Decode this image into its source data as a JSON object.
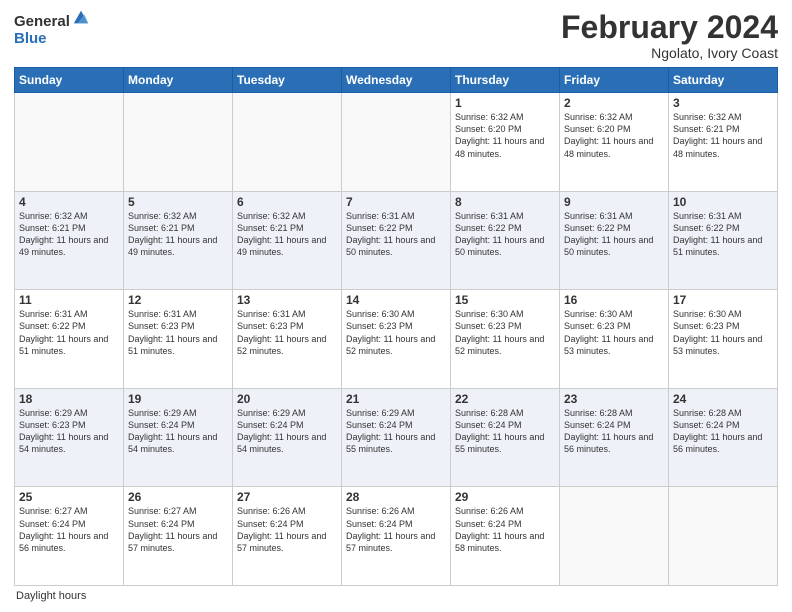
{
  "logo": {
    "general": "General",
    "blue": "Blue"
  },
  "title": "February 2024",
  "subtitle": "Ngolato, Ivory Coast",
  "days_of_week": [
    "Sunday",
    "Monday",
    "Tuesday",
    "Wednesday",
    "Thursday",
    "Friday",
    "Saturday"
  ],
  "footer": "Daylight hours",
  "weeks": [
    [
      {
        "day": "",
        "info": ""
      },
      {
        "day": "",
        "info": ""
      },
      {
        "day": "",
        "info": ""
      },
      {
        "day": "",
        "info": ""
      },
      {
        "day": "1",
        "info": "Sunrise: 6:32 AM\nSunset: 6:20 PM\nDaylight: 11 hours and 48 minutes."
      },
      {
        "day": "2",
        "info": "Sunrise: 6:32 AM\nSunset: 6:20 PM\nDaylight: 11 hours and 48 minutes."
      },
      {
        "day": "3",
        "info": "Sunrise: 6:32 AM\nSunset: 6:21 PM\nDaylight: 11 hours and 48 minutes."
      }
    ],
    [
      {
        "day": "4",
        "info": "Sunrise: 6:32 AM\nSunset: 6:21 PM\nDaylight: 11 hours and 49 minutes."
      },
      {
        "day": "5",
        "info": "Sunrise: 6:32 AM\nSunset: 6:21 PM\nDaylight: 11 hours and 49 minutes."
      },
      {
        "day": "6",
        "info": "Sunrise: 6:32 AM\nSunset: 6:21 PM\nDaylight: 11 hours and 49 minutes."
      },
      {
        "day": "7",
        "info": "Sunrise: 6:31 AM\nSunset: 6:22 PM\nDaylight: 11 hours and 50 minutes."
      },
      {
        "day": "8",
        "info": "Sunrise: 6:31 AM\nSunset: 6:22 PM\nDaylight: 11 hours and 50 minutes."
      },
      {
        "day": "9",
        "info": "Sunrise: 6:31 AM\nSunset: 6:22 PM\nDaylight: 11 hours and 50 minutes."
      },
      {
        "day": "10",
        "info": "Sunrise: 6:31 AM\nSunset: 6:22 PM\nDaylight: 11 hours and 51 minutes."
      }
    ],
    [
      {
        "day": "11",
        "info": "Sunrise: 6:31 AM\nSunset: 6:22 PM\nDaylight: 11 hours and 51 minutes."
      },
      {
        "day": "12",
        "info": "Sunrise: 6:31 AM\nSunset: 6:23 PM\nDaylight: 11 hours and 51 minutes."
      },
      {
        "day": "13",
        "info": "Sunrise: 6:31 AM\nSunset: 6:23 PM\nDaylight: 11 hours and 52 minutes."
      },
      {
        "day": "14",
        "info": "Sunrise: 6:30 AM\nSunset: 6:23 PM\nDaylight: 11 hours and 52 minutes."
      },
      {
        "day": "15",
        "info": "Sunrise: 6:30 AM\nSunset: 6:23 PM\nDaylight: 11 hours and 52 minutes."
      },
      {
        "day": "16",
        "info": "Sunrise: 6:30 AM\nSunset: 6:23 PM\nDaylight: 11 hours and 53 minutes."
      },
      {
        "day": "17",
        "info": "Sunrise: 6:30 AM\nSunset: 6:23 PM\nDaylight: 11 hours and 53 minutes."
      }
    ],
    [
      {
        "day": "18",
        "info": "Sunrise: 6:29 AM\nSunset: 6:23 PM\nDaylight: 11 hours and 54 minutes."
      },
      {
        "day": "19",
        "info": "Sunrise: 6:29 AM\nSunset: 6:24 PM\nDaylight: 11 hours and 54 minutes."
      },
      {
        "day": "20",
        "info": "Sunrise: 6:29 AM\nSunset: 6:24 PM\nDaylight: 11 hours and 54 minutes."
      },
      {
        "day": "21",
        "info": "Sunrise: 6:29 AM\nSunset: 6:24 PM\nDaylight: 11 hours and 55 minutes."
      },
      {
        "day": "22",
        "info": "Sunrise: 6:28 AM\nSunset: 6:24 PM\nDaylight: 11 hours and 55 minutes."
      },
      {
        "day": "23",
        "info": "Sunrise: 6:28 AM\nSunset: 6:24 PM\nDaylight: 11 hours and 56 minutes."
      },
      {
        "day": "24",
        "info": "Sunrise: 6:28 AM\nSunset: 6:24 PM\nDaylight: 11 hours and 56 minutes."
      }
    ],
    [
      {
        "day": "25",
        "info": "Sunrise: 6:27 AM\nSunset: 6:24 PM\nDaylight: 11 hours and 56 minutes."
      },
      {
        "day": "26",
        "info": "Sunrise: 6:27 AM\nSunset: 6:24 PM\nDaylight: 11 hours and 57 minutes."
      },
      {
        "day": "27",
        "info": "Sunrise: 6:26 AM\nSunset: 6:24 PM\nDaylight: 11 hours and 57 minutes."
      },
      {
        "day": "28",
        "info": "Sunrise: 6:26 AM\nSunset: 6:24 PM\nDaylight: 11 hours and 57 minutes."
      },
      {
        "day": "29",
        "info": "Sunrise: 6:26 AM\nSunset: 6:24 PM\nDaylight: 11 hours and 58 minutes."
      },
      {
        "day": "",
        "info": ""
      },
      {
        "day": "",
        "info": ""
      }
    ]
  ]
}
